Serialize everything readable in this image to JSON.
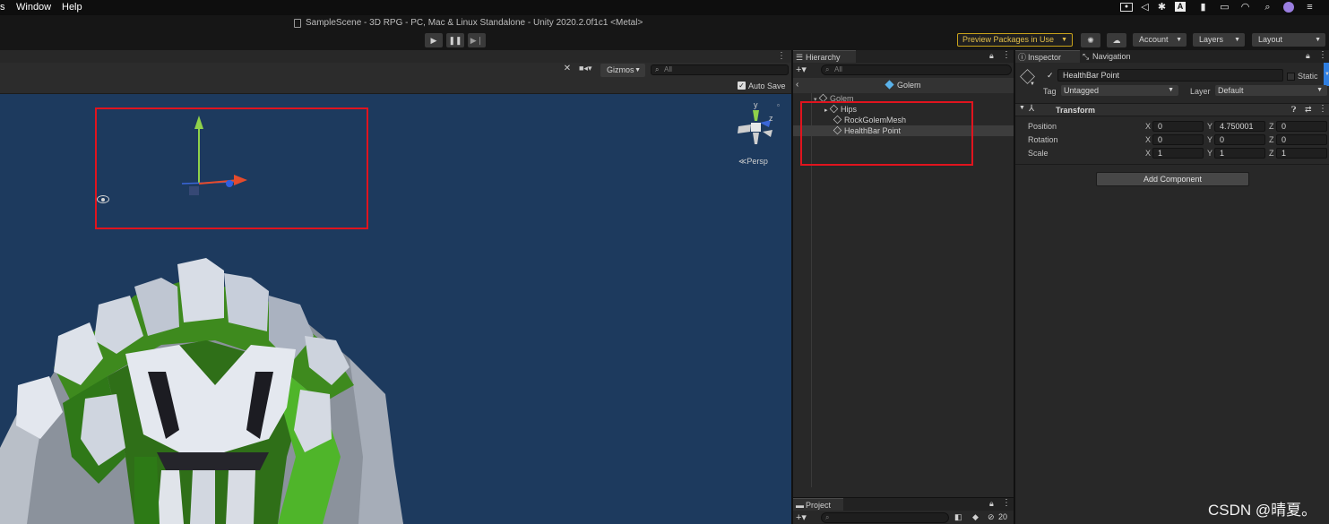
{
  "menubar": {
    "items": [
      "s",
      "Window",
      "Help"
    ]
  },
  "window": {
    "title": "SampleScene - 3D RPG - PC, Mac & Linux Standalone - Unity 2020.2.0f1c1 <Metal>"
  },
  "toolbar": {
    "preview_packages": "Preview Packages in Use",
    "account": "Account",
    "layers": "Layers",
    "layout": "Layout"
  },
  "scene": {
    "gizmos_label": "Gizmos",
    "search_placeholder": "All",
    "auto_save": "Auto Save",
    "persp_label": "Persp",
    "axis_y": "y",
    "axis_z": "z",
    "accent_color": "#e0141e"
  },
  "hierarchy": {
    "tab": "Hierarchy",
    "search_placeholder": "All",
    "prefab": "Golem",
    "items": [
      {
        "label": "Golem"
      },
      {
        "label": "Hips"
      },
      {
        "label": "RockGolemMesh"
      },
      {
        "label": "HealthBar Point"
      }
    ]
  },
  "project": {
    "tab": "Project",
    "hidden_count": "20"
  },
  "inspector": {
    "tabs": [
      "Inspector",
      "Navigation"
    ],
    "object_name": "HealthBar Point",
    "static_label": "Static",
    "tag_label": "Tag",
    "tag_value": "Untagged",
    "layer_label": "Layer",
    "layer_value": "Default",
    "component": "Transform",
    "rows": [
      {
        "label": "Position",
        "x": "0",
        "y": "4.750001",
        "z": "0"
      },
      {
        "label": "Rotation",
        "x": "0",
        "y": "0",
        "z": "0"
      },
      {
        "label": "Scale",
        "x": "1",
        "y": "1",
        "z": "1"
      }
    ],
    "add_component": "Add Component"
  },
  "watermark": "CSDN @晴夏。"
}
